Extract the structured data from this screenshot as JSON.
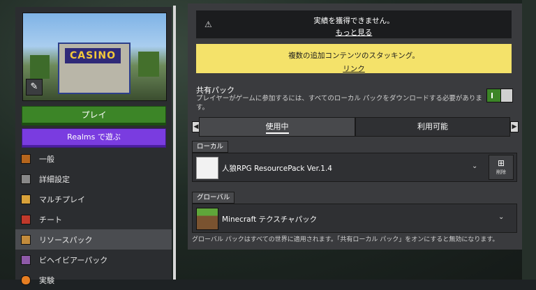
{
  "world": {
    "thumbnail_sign": "CASINO",
    "play_label": "プレイ",
    "realms_label": "Realms で遊ぶ"
  },
  "menu": {
    "items": [
      {
        "label": "一般",
        "icon": "general-icon"
      },
      {
        "label": "詳細設定",
        "icon": "advanced-settings-icon"
      },
      {
        "label": "マルチプレイ",
        "icon": "multiplayer-icon"
      },
      {
        "label": "チート",
        "icon": "cheats-icon"
      },
      {
        "label": "リソースパック",
        "icon": "resource-pack-icon",
        "active": true
      },
      {
        "label": "ビヘイビアーパック",
        "icon": "behavior-pack-icon"
      },
      {
        "label": "実験",
        "icon": "experiments-icon"
      }
    ]
  },
  "notices": {
    "achievements_text": "実績を獲得できません。",
    "achievements_link": "もっと見る",
    "stacking_text": "複数の追加コンテンツのスタッキング。",
    "stacking_link": "リンク"
  },
  "shared_pack": {
    "title": "共有パック",
    "description": "プレイヤーがゲームに参加するには、すべてのローカル パックをダウンロードする必要がありま す。",
    "toggle_on": true
  },
  "tabs": {
    "used": "使用中",
    "available": "利用可能"
  },
  "local": {
    "label": "ローカル",
    "pack_name": "人狼RPG ResourcePack Ver.1.4",
    "delete_label": "削除"
  },
  "global": {
    "label": "グローバル",
    "pack_name": "Minecraft テクスチャパック",
    "note": "グローバル パックはすべての世界に適用されます。「共有ローカル パック」をオンにすると無効になります。"
  },
  "colors": {
    "play_green": "#3c8527",
    "realms_purple": "#7a3ce0",
    "warning_yellow": "#f4e26a"
  }
}
